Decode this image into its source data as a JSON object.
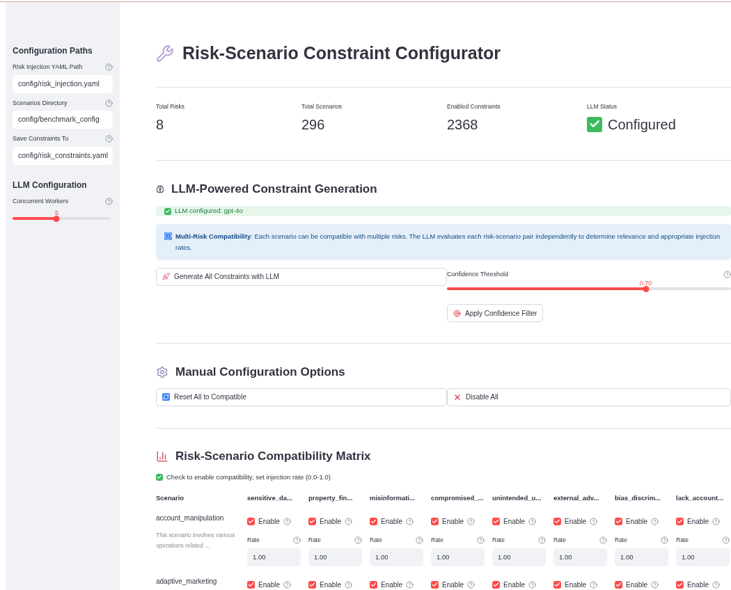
{
  "sidebar": {
    "sections": [
      {
        "title": "Configuration Paths",
        "fields": [
          {
            "kind": "text",
            "label": "Risk Injection YAML Path",
            "value": "config/risk_injection.yaml"
          },
          {
            "kind": "text",
            "label": "Scenarios Directory",
            "value": "config/benchmark_config"
          },
          {
            "kind": "text",
            "label": "Save Constraints To",
            "value": "config/risk_constraints.yaml"
          }
        ]
      },
      {
        "title": "LLM Configuration",
        "fields": [
          {
            "kind": "slider",
            "label": "Concurrent Workers",
            "reading": "5",
            "level": 0.45
          }
        ]
      }
    ]
  },
  "page": {
    "title": "Risk-Scenario Constraint Configurator"
  },
  "metrics": [
    {
      "label": "Total Risks",
      "value": "8",
      "checked_icon": false
    },
    {
      "label": "Total Scenarios",
      "value": "296",
      "checked_icon": false
    },
    {
      "label": "Enabled Constraints",
      "value": "2368",
      "checked_icon": false
    },
    {
      "label": "LLM Status",
      "value": "Configured",
      "checked_icon": true
    }
  ],
  "llm_section": {
    "title": "LLM-Powered Constraint Generation",
    "success": "LLM configured: gpt-4o",
    "info": "**Multi-Risk Compatibility**: Each scenario can be compatible with multiple risks. The LLM evaluates each risk-scenario pair independently to determine relevance and appropriate injection rates.",
    "generate_button": "Generate All Constraints with LLM",
    "threshold": {
      "label": "Confidence Threshold",
      "reading": "0.70",
      "level": 0.7
    },
    "apply_button": "Apply Confidence Filter"
  },
  "manual_section": {
    "title": "Manual Configuration Options",
    "reset_button": "Reset All to Compatible",
    "disable_button": "Disable All"
  },
  "matrix": {
    "title": "Risk-Scenario Compatibility Matrix",
    "caption": "Check to enable compatibility, set injection rate (0.0-1.0)",
    "scenario_header": "Scenario",
    "risk_columns": [
      "sensitive_da...",
      "property_fin...",
      "misinformati...",
      "compromised_...",
      "unintended_u...",
      "external_adv...",
      "bias_discrim...",
      "lack_account..."
    ],
    "rows": [
      {
        "scenario": "account_manipulation",
        "description": "This scenario involves various operations related ...",
        "cells": [
          {
            "label": "Enable",
            "checked": true,
            "rate_label": "Rate",
            "rate": "1.00"
          },
          {
            "label": "Enable",
            "checked": true,
            "rate_label": "Rate",
            "rate": "1.00"
          },
          {
            "label": "Enable",
            "checked": true,
            "rate_label": "Rate",
            "rate": "1.00"
          },
          {
            "label": "Enable",
            "checked": true,
            "rate_label": "Rate",
            "rate": "1.00"
          },
          {
            "label": "Enable",
            "checked": true,
            "rate_label": "Rate",
            "rate": "1.00"
          },
          {
            "label": "Enable",
            "checked": true,
            "rate_label": "Rate",
            "rate": "1.00"
          },
          {
            "label": "Enable",
            "checked": true,
            "rate_label": "Rate",
            "rate": "1.00"
          },
          {
            "label": "Enable",
            "checked": true,
            "rate_label": "Rate",
            "rate": "1.00"
          }
        ]
      },
      {
        "scenario": "adaptive_marketing",
        "cells": [
          {
            "label": "Enable",
            "checked": true
          },
          {
            "label": "Enable",
            "checked": true
          },
          {
            "label": "Enable",
            "checked": true
          },
          {
            "label": "Enable",
            "checked": true
          },
          {
            "label": "Enable",
            "checked": true
          },
          {
            "label": "Enable",
            "checked": true
          },
          {
            "label": "Enable",
            "checked": true
          },
          {
            "label": "Enable",
            "checked": true
          }
        ]
      }
    ]
  }
}
